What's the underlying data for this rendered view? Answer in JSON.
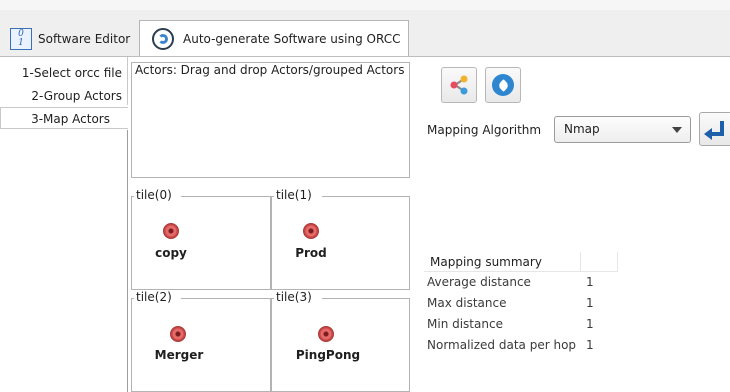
{
  "tabs": {
    "software_editor": "Software Editor",
    "orcc": "Auto-generate Software using ORCC"
  },
  "steps": [
    "1-Select orcc file",
    "2-Group Actors",
    "3-Map Actors"
  ],
  "actors_panel": {
    "title": "Actors: Drag and drop Actors/grouped Actors"
  },
  "tiles": [
    {
      "title": "tile(0)",
      "actor": "copy"
    },
    {
      "title": "tile(1)",
      "actor": "Prod"
    },
    {
      "title": "tile(2)",
      "actor": "Merger"
    },
    {
      "title": "tile(3)",
      "actor": "PingPong"
    }
  ],
  "mapping": {
    "label": "Mapping Algorithm",
    "selected": "Nmap"
  },
  "summary": {
    "header": "Mapping summary",
    "rows": [
      {
        "label": "Average distance",
        "value": "1"
      },
      {
        "label": "Max distance",
        "value": "1"
      },
      {
        "label": "Min distance",
        "value": "1"
      },
      {
        "label": "Normalized data per hop",
        "value": "1"
      }
    ]
  },
  "icons": {
    "software_editor_tab": "software-editor-icon",
    "orcc_tab": "orcc-logo-icon",
    "share": "share-icon",
    "clean": "broom-icon",
    "enter": "enter-icon",
    "actor": "actor-icon"
  },
  "colors": {
    "actor_red": "#c94444",
    "accent_blue": "#1d5fa8"
  }
}
